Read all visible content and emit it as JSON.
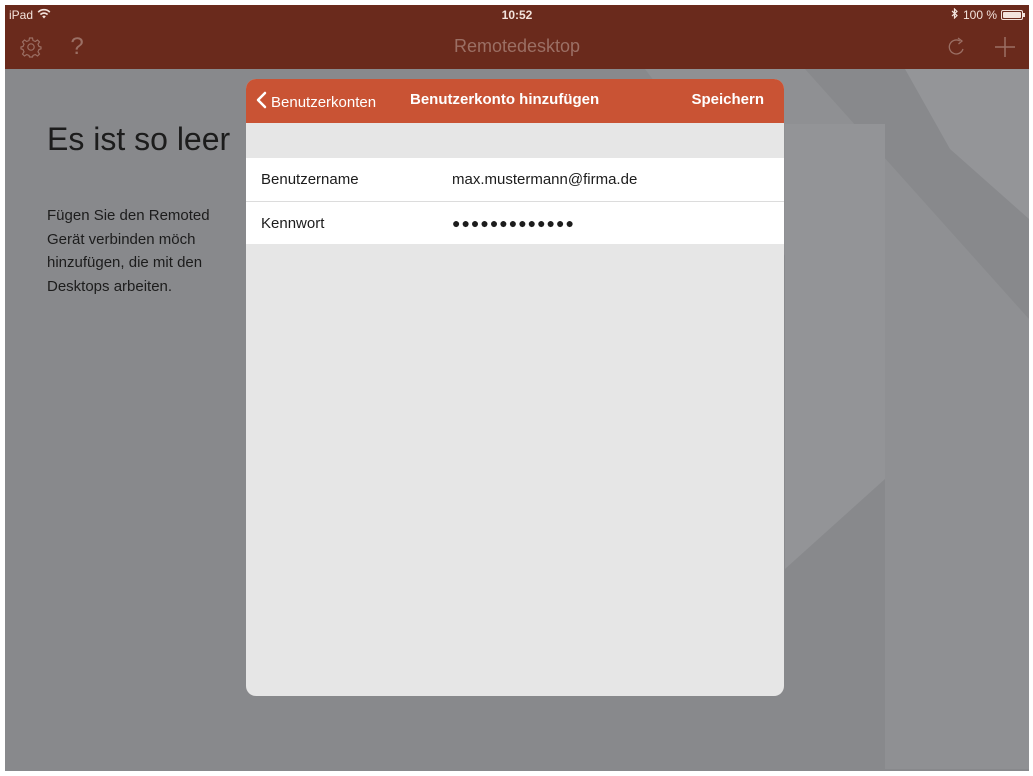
{
  "statusbar": {
    "device": "iPad",
    "time": "10:52",
    "battery_text": "100 %",
    "battery_level": 1.0
  },
  "navbar": {
    "title": "Remotedesktop",
    "left_icons": [
      "gear-icon",
      "question-icon"
    ],
    "right_icons": [
      "refresh-icon",
      "plus-icon"
    ]
  },
  "background": {
    "empty_title": "Es ist so leer",
    "empty_desc_lines": [
      "Fügen Sie den Remoted",
      "Gerät  verbinden  möch",
      "hinzufügen, die mit den",
      "Desktops arbeiten."
    ]
  },
  "modal": {
    "back_label": "Benutzerkonten",
    "title": "Benutzerkonto hinzufügen",
    "save_label": "Speichern",
    "fields": [
      {
        "label": "Benutzername",
        "value": "max.mustermann@firma.de"
      },
      {
        "label": "Kennwort",
        "value": "●●●●●●●●●●●●●"
      }
    ]
  },
  "colors": {
    "navbar": "#6a2a1c",
    "modal_header": "#c95334",
    "background": "#88898c",
    "modal_body": "#e6e6e6"
  }
}
